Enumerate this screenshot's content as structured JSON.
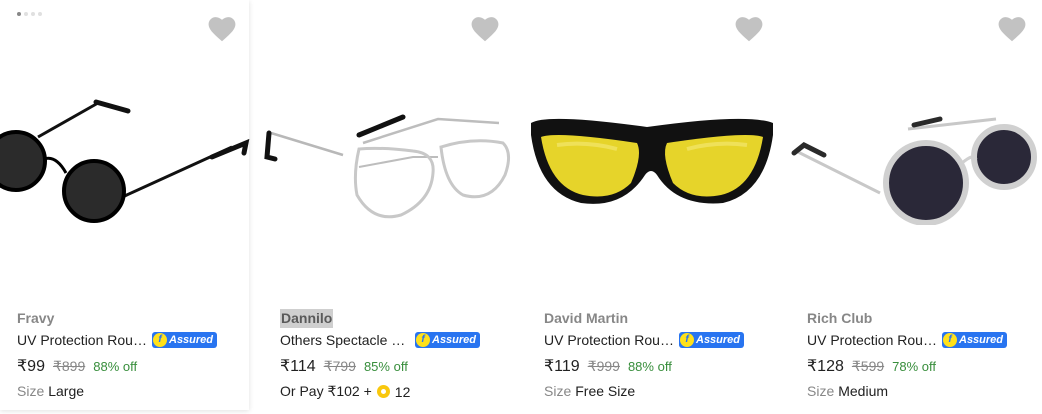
{
  "products": [
    {
      "brand": "Fravy",
      "title": "UV Protection Round Sunglasses (Free Size)",
      "assured_label": "Assured",
      "price": "₹99",
      "mrp": "₹899",
      "discount": "88% off",
      "extra_label": "Size",
      "extra_value": "Large",
      "image_icon": "round-black-sunglasses"
    },
    {
      "brand": "Dannilo",
      "title": "Others Spectacle Sunglasses (Free Size)",
      "assured_label": "Assured",
      "price": "₹114",
      "mrp": "₹799",
      "discount": "85% off",
      "pay_text": "Or Pay ₹102 +",
      "coin_count": "12",
      "image_icon": "aviator-clear-glasses"
    },
    {
      "brand": "David Martin",
      "title": "UV Protection Round Sunglasses (Free Size)",
      "assured_label": "Assured",
      "price": "₹119",
      "mrp": "₹999",
      "discount": "88% off",
      "extra_label": "Size",
      "extra_value": "Free Size",
      "image_icon": "yellow-night-vision-sunglasses"
    },
    {
      "brand": "Rich Club",
      "title": "UV Protection Round Sunglasses (Free Size)",
      "assured_label": "Assured",
      "price": "₹128",
      "mrp": "₹599",
      "discount": "78% off",
      "extra_label": "Size",
      "extra_value": "Medium",
      "image_icon": "round-silver-sunglasses"
    }
  ],
  "carousel": {
    "dots": 4,
    "active": 0
  },
  "colors": {
    "assured_bg": "#2874f0",
    "discount_green": "#388e3c",
    "muted_text": "#878787",
    "wishlist_heart": "#c2c2c2"
  }
}
